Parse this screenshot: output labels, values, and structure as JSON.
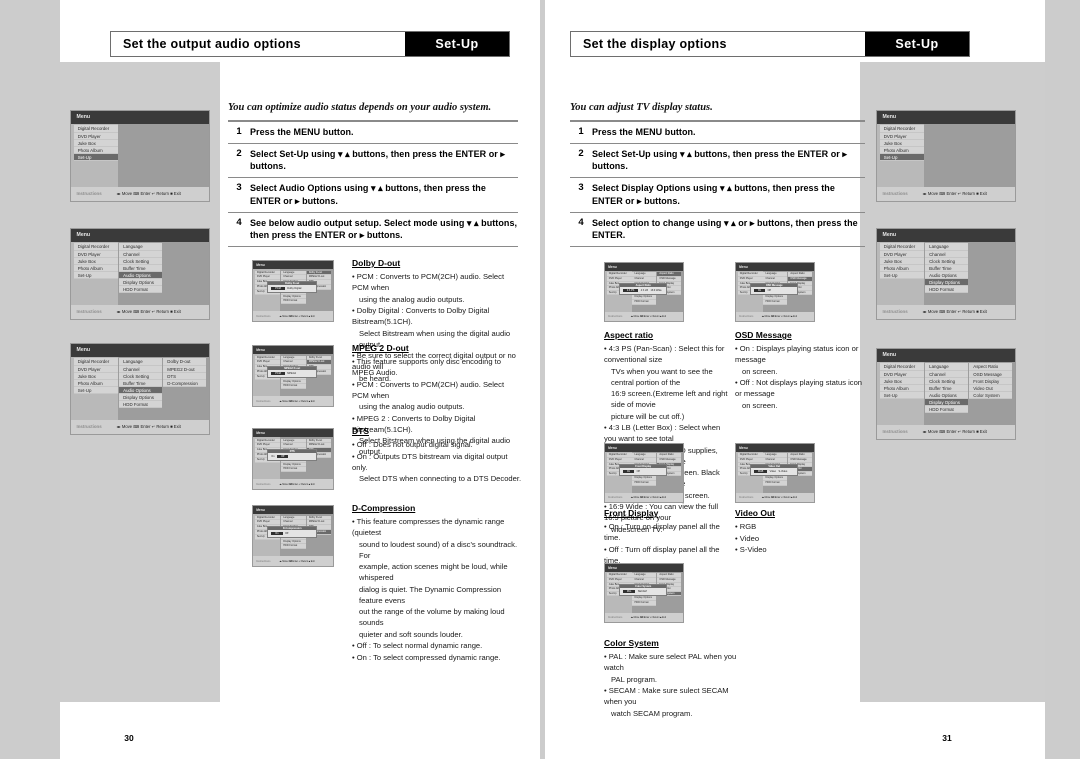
{
  "left_page": {
    "header": {
      "title": "Set the output audio options",
      "tag": "Set-Up"
    },
    "intro": "You can optimize audio status depends on your audio system.",
    "steps": [
      {
        "n": "1",
        "text": "Press the MENU button."
      },
      {
        "n": "2",
        "text": "Select Set-Up using ▾ ▴ buttons, then press the ENTER or ▸ buttons."
      },
      {
        "n": "3",
        "text": "Select Audio Options using ▾ ▴ buttons, then press the ENTER or ▸ buttons."
      },
      {
        "n": "4",
        "text": "See below audio output setup. Select mode using ▾ ▴ buttons, then press the ENTER or ▸ buttons."
      }
    ],
    "page_number": "30"
  },
  "right_page": {
    "header": {
      "title": "Set the display options",
      "tag": "Set-Up"
    },
    "intro": "You can adjust TV display status.",
    "steps": [
      {
        "n": "1",
        "text": "Press the MENU button."
      },
      {
        "n": "2",
        "text": "Select Set-Up using ▾ ▴ buttons, then press the ENTER or ▸ buttons."
      },
      {
        "n": "3",
        "text": "Select Display Options using ▾ ▴ buttons, then press the ENTER or ▸ buttons."
      },
      {
        "n": "4",
        "text": "Select option to change using ▾ ▴ or ▸ buttons, then press the ENTER."
      }
    ],
    "page_number": "31"
  },
  "menu": {
    "title": "Menu",
    "instructions_label": "Instructions",
    "instructions_keys": "◂▸ Move ⌨ Enter ↵ Return ■ Exit",
    "top_level": [
      "Digital Recorder",
      "DVD Player",
      "Juke Box",
      "Photo Album",
      "Set-Up"
    ],
    "setup_items": [
      "Language",
      "Channel",
      "Clock Setting",
      "Buffer Time",
      "Audio Options",
      "Display Options",
      "HDD Format"
    ],
    "audio_items": [
      "Dolby D-out",
      "MPEG2 D-out",
      "DTS",
      "D-Compression"
    ],
    "display_items": [
      "Aspect Ratio",
      "OSD Message",
      "Front Display",
      "Video Out",
      "Color System"
    ]
  },
  "audio_options": [
    {
      "key": "dolby",
      "title": "Dolby D-out",
      "dialog_title": "Dolby D-out",
      "dialog_options": [
        "PCM",
        "Dolby Digital"
      ],
      "dialog_selected": "PCM",
      "menu_highlight": "Dolby D-out",
      "bullets": [
        {
          "text": "• PCM : Converts to PCM(2CH) audio. Select PCM when",
          "indent": false
        },
        {
          "text": "using the analog audio outputs.",
          "indent": true
        },
        {
          "text": "• Dolby Digital : Converts to Dolby Digital Bitstream(5.1CH).",
          "indent": false
        },
        {
          "text": "Select Bitstream when using the digital audio output.",
          "indent": true
        },
        {
          "text": "• Be sure to select the correct digital output or no audio will",
          "indent": false
        },
        {
          "text": "be heard.",
          "indent": true
        }
      ]
    },
    {
      "key": "mpeg2",
      "title": "MPEG 2 D-out",
      "dialog_title": "MPEG2 D-out",
      "dialog_options": [
        "PCM",
        "MPEG2"
      ],
      "dialog_selected": "PCM",
      "menu_highlight": "MPEG2 D-out",
      "bullets": [
        {
          "text": "• This feature supports only disc encoding to MPEG Audio.",
          "indent": false
        },
        {
          "text": "• PCM : Converts to PCM(2CH) audio. Select PCM when",
          "indent": false
        },
        {
          "text": "using the analog audio outputs.",
          "indent": true
        },
        {
          "text": "• MPEG 2 : Converts to Dolby Digital Bitstream(5.1CH).",
          "indent": false
        },
        {
          "text": "Select Bitstream when using the digital audio output.",
          "indent": true
        }
      ]
    },
    {
      "key": "dts",
      "title": "DTS",
      "dialog_title": "DTS",
      "dialog_options": [
        "On",
        "Off"
      ],
      "dialog_selected": "Off",
      "menu_highlight": "DTS",
      "bullets": [
        {
          "text": "• Off : Does not output digital signal.",
          "indent": false
        },
        {
          "text": "• On : Outputs DTS bitstream via digital output only.",
          "indent": false
        },
        {
          "text": "Select DTS when connecting to a DTS Decoder.",
          "indent": true
        }
      ]
    },
    {
      "key": "dcomp",
      "title": "D-Compression",
      "dialog_title": "D-Compression",
      "dialog_options": [
        "On",
        "Off"
      ],
      "dialog_selected": "On",
      "menu_highlight": "D-Compression",
      "bullets": [
        {
          "text": "• This feature compresses the dynamic range (quietest",
          "indent": false
        },
        {
          "text": "sound to loudest sound) of a disc's soundtrack. For",
          "indent": true
        },
        {
          "text": "example, action scenes might be loud, while whispered",
          "indent": true
        },
        {
          "text": "dialog is quiet. The Dynamic Compression feature evens",
          "indent": true
        },
        {
          "text": "out the range of the volume by making loud sounds",
          "indent": true
        },
        {
          "text": "quieter and soft sounds louder.",
          "indent": true
        },
        {
          "text": "• Off : To select normal dynamic range.",
          "indent": false
        },
        {
          "text": "• On : To select compressed dynamic range.",
          "indent": false
        }
      ]
    }
  ],
  "display_options": [
    {
      "key": "aspect",
      "title": "Aspect ratio",
      "dialog_title": "Aspect Ratio",
      "dialog_options": [
        "4:3 PS",
        "4:3 LB",
        "16:9 Wide"
      ],
      "dialog_selected": "4:3 PS",
      "menu_highlight": "Aspect Ratio",
      "bullets": [
        {
          "text": "• 4:3 PS (Pan-Scan) : Select this for conventional size",
          "indent": false
        },
        {
          "text": "TVs when you want to see the central portion of the",
          "indent": true
        },
        {
          "text": "16:9 screen.(Extreme left and right side of movie",
          "indent": true
        },
        {
          "text": "picture will be cut off.)",
          "indent": true
        },
        {
          "text": "• 4:3 LB (Letter Box) : Select when you want to see total",
          "indent": false
        },
        {
          "text": "16:9 ratio screen DVD supplies, even though you have",
          "indent": true
        },
        {
          "text": "a TV with 4:3 ratio screen. Black bars will appear at the",
          "indent": true
        },
        {
          "text": "top and bottom of the screen.",
          "indent": true
        },
        {
          "text": "• 16:9 Wide : You can view the full 16:9 picture on your",
          "indent": false
        },
        {
          "text": "widescreen TV.",
          "indent": true
        }
      ]
    },
    {
      "key": "osd",
      "title": "OSD Message",
      "dialog_title": "OSD Message",
      "dialog_options": [
        "On",
        "Off"
      ],
      "dialog_selected": "On",
      "menu_highlight": "OSD Message",
      "bullets": [
        {
          "text": "• On : Displays playing status icon or message",
          "indent": false
        },
        {
          "text": "on screen.",
          "indent": true
        },
        {
          "text": "• Off : Not displays playing status icon or message",
          "indent": false
        },
        {
          "text": "on screen.",
          "indent": true
        }
      ]
    },
    {
      "key": "front",
      "title": "Front Display",
      "dialog_title": "Front Display",
      "dialog_options": [
        "On",
        "Off"
      ],
      "dialog_selected": "On",
      "menu_highlight": "Front Display",
      "bullets": [
        {
          "text": "• On : Turn on display panel all the time.",
          "indent": false
        },
        {
          "text": "• Off : Turn off display panel all the time.",
          "indent": false
        }
      ]
    },
    {
      "key": "videoout",
      "title": "Video Out",
      "dialog_title": "Video Out",
      "dialog_options": [
        "RGB",
        "Video",
        "S-Video"
      ],
      "dialog_selected": "RGB",
      "menu_highlight": "Video Out",
      "bullets": [
        {
          "text": "• RGB",
          "indent": false
        },
        {
          "text": "• Video",
          "indent": false
        },
        {
          "text": "• S-Video",
          "indent": false
        }
      ]
    },
    {
      "key": "color",
      "title": "Color System",
      "dialog_title": "Color System",
      "dialog_options": [
        "PAL",
        "SECAM"
      ],
      "dialog_selected": "PAL",
      "menu_highlight": "Color System",
      "bullets": [
        {
          "text": "• PAL : Make sure select PAL when you watch",
          "indent": false
        },
        {
          "text": "PAL program.",
          "indent": true
        },
        {
          "text": "• SECAM : Make sure sulect SECAM when you",
          "indent": false
        },
        {
          "text": "watch SECAM program.",
          "indent": true
        }
      ]
    }
  ]
}
